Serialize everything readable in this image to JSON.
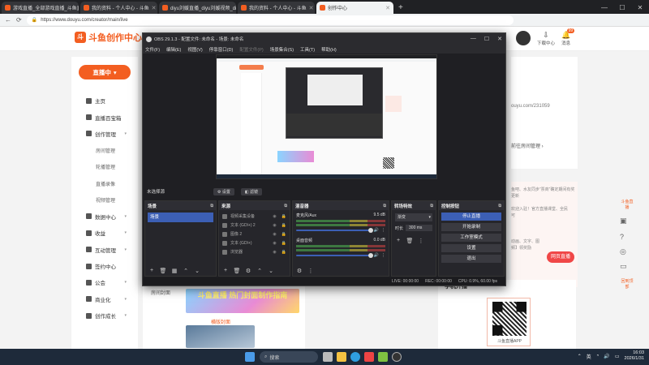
{
  "browser": {
    "tabs": [
      {
        "title": "游戏直播_全部游戏直播_斗鱼直播",
        "active": false
      },
      {
        "title": "我的资料 - 个人中心 - 斗鱼",
        "active": false
      },
      {
        "title": "diyu刘媛直播_diyu刘媛视频_diyu刘...",
        "active": false
      },
      {
        "title": "我的资料 - 个人中心 - 斗鱼",
        "active": false
      },
      {
        "title": "创作中心",
        "active": true
      }
    ],
    "url": "https://www.douyu.com/creator/main/live"
  },
  "header": {
    "logo_text": "斗鱼创作中心",
    "download_label": "下载中心",
    "messages_label": "消息",
    "messages_badge": "99"
  },
  "sidebar": {
    "live_button": "直播中",
    "items": [
      {
        "label": "主页",
        "type": "top"
      },
      {
        "label": "直播百宝箱",
        "type": "top"
      },
      {
        "label": "创作管理",
        "type": "group"
      },
      {
        "label": "房间管理",
        "type": "sub"
      },
      {
        "label": "轮播管理",
        "type": "sub"
      },
      {
        "label": "直播录像",
        "type": "sub"
      },
      {
        "label": "视频管理",
        "type": "sub"
      },
      {
        "label": "数据中心",
        "type": "group"
      },
      {
        "label": "收益",
        "type": "group"
      },
      {
        "label": "互动管理",
        "type": "group"
      },
      {
        "label": "签约中心",
        "type": "top"
      },
      {
        "label": "公会",
        "type": "group"
      },
      {
        "label": "商业化",
        "type": "group"
      },
      {
        "label": "创作成长",
        "type": "group"
      }
    ]
  },
  "main": {
    "room_url_partial": "ouyu.com/231059",
    "manage_link": "前往房间管理",
    "notice_lines": [
      "鱼吧、水友同步“票商”确定期间有奖",
      "更新"
    ],
    "notice_lines_2": [
      "欢迎入驻！官方直播课堂、全民",
      "可"
    ],
    "cover_label": "房间封面",
    "cover_title": "斗鱼直播 热门封面制作指南",
    "cover_label_2": "横版封面",
    "web_live_button": "网页直播",
    "app_title": "手机开播",
    "app_caption": "斗鱼直播APP",
    "small_notes": [
      "动画、文字、图",
      "频】领奖励"
    ]
  },
  "right_rail": [
    "斗鱼直播",
    "直播",
    "客服",
    "反馈",
    "建议",
    "回到顶部"
  ],
  "obs": {
    "title": "OBS 29.1.3 - 配置文件: 未命名 - 场景: 未命名",
    "menu": [
      "文件(F)",
      "编辑(E)",
      "视图(V)",
      "停靠窗口(D)",
      "配置文件(P)",
      "场景集合(S)",
      "工具(T)",
      "帮助(H)"
    ],
    "no_source": "未选择源",
    "settings_btn": "设置",
    "filters_btn": "滤镜",
    "docks": {
      "scenes": {
        "title": "场景",
        "items": [
          "场景"
        ]
      },
      "sources": {
        "title": "来源",
        "items": [
          "视频采集设备",
          "文本 (GDI+) 2",
          "图像 2",
          "文本 (GDI+)",
          "浏览器"
        ]
      },
      "mixer": {
        "title": "混音器",
        "channels": [
          {
            "name": "麦克风/Aux",
            "db": "9.5 dB"
          },
          {
            "name": "桌面音频",
            "db": "0.0 dB"
          }
        ]
      },
      "transitions": {
        "title": "转场特效",
        "type": "渐变",
        "duration_label": "时长",
        "duration_value": "300 ms"
      },
      "controls": {
        "title": "控制按钮",
        "buttons": [
          "停止直播",
          "开始录制",
          "工作室模式",
          "设置",
          "退出"
        ]
      }
    },
    "status": {
      "live": "LIVE: 00:00:00",
      "rec": "REC: 00:00:00",
      "cpu": "CPU: 0.9%, 60.00 fps"
    }
  },
  "taskbar": {
    "search": "搜索",
    "tray_lang": "英",
    "time": "16:03",
    "date": "2026/1/31"
  }
}
